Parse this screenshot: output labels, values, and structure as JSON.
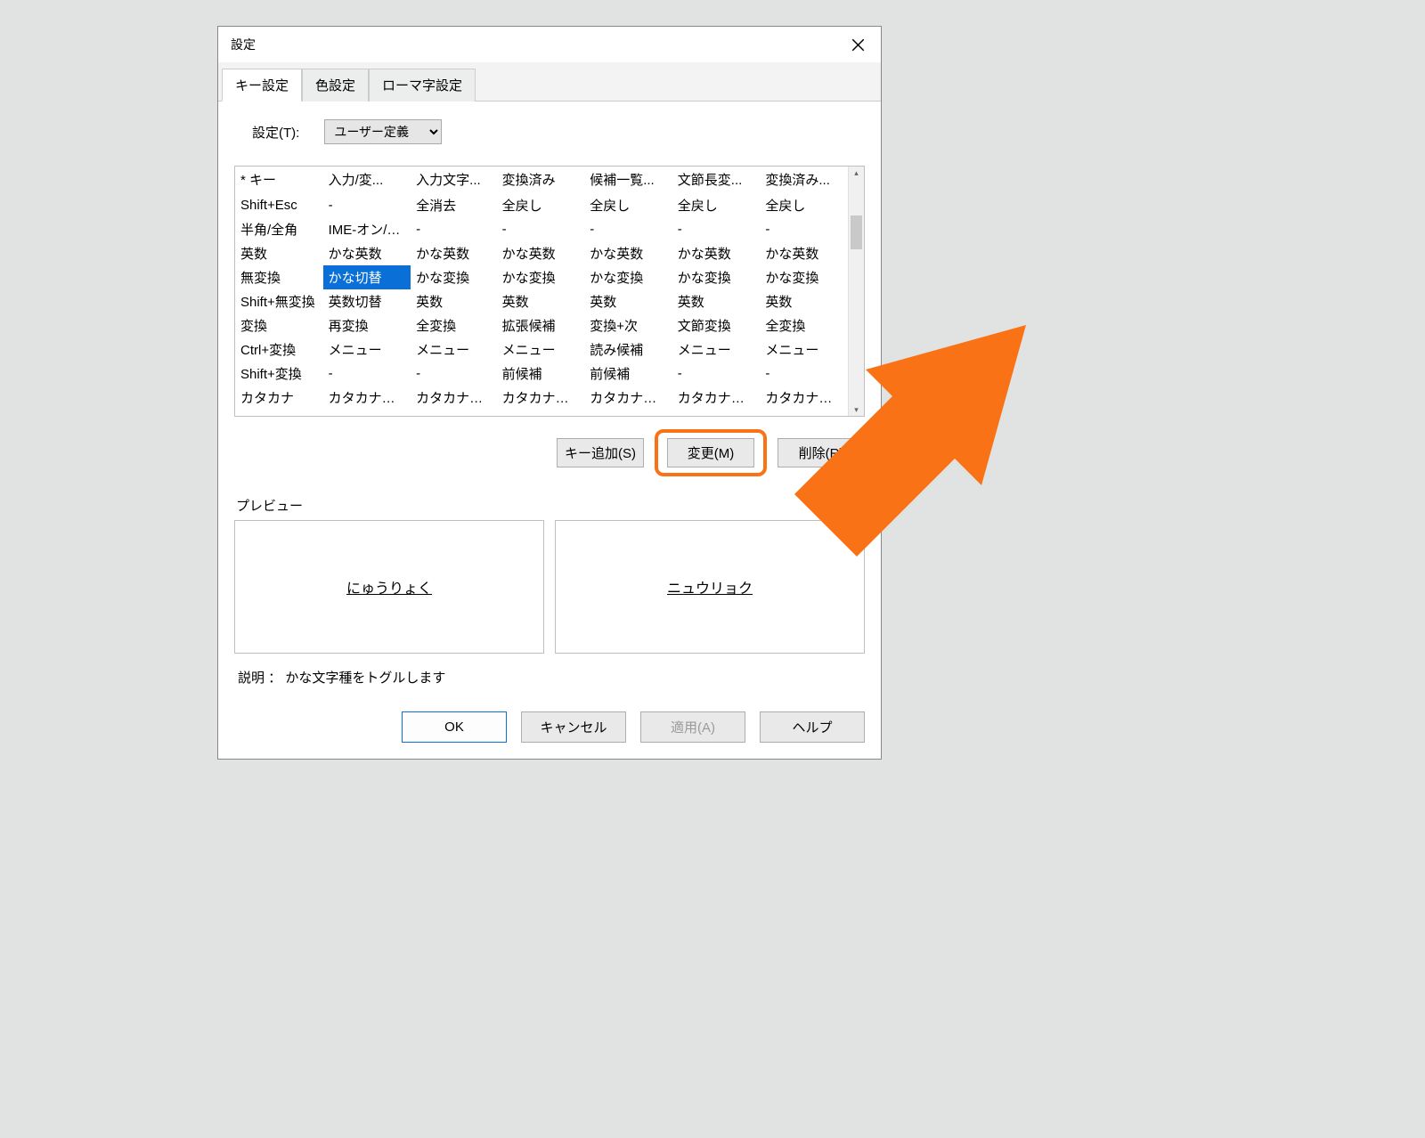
{
  "titlebar": {
    "title": "設定"
  },
  "tabs": [
    {
      "label": "キー設定",
      "active": true
    },
    {
      "label": "色設定",
      "active": false
    },
    {
      "label": "ローマ字設定",
      "active": false
    }
  ],
  "setting": {
    "label": "設定(T):",
    "selected": "ユーザー定義"
  },
  "table": {
    "headers": [
      "* キー",
      "入力/変...",
      "入力文字...",
      "変換済み",
      "候補一覧...",
      "文節長変...",
      "変換済み..."
    ],
    "rows": [
      [
        "Shift+Esc",
        "-",
        "全消去",
        "全戻し",
        "全戻し",
        "全戻し",
        "全戻し"
      ],
      [
        "半角/全角",
        "IME-オン/オフ",
        "-",
        "-",
        "-",
        "-",
        "-"
      ],
      [
        "英数",
        "かな英数",
        "かな英数",
        "かな英数",
        "かな英数",
        "かな英数",
        "かな英数"
      ],
      [
        "無変換",
        "かな切替",
        "かな変換",
        "かな変換",
        "かな変換",
        "かな変換",
        "かな変換"
      ],
      [
        "Shift+無変換",
        "英数切替",
        "英数",
        "英数",
        "英数",
        "英数",
        "英数"
      ],
      [
        "変換",
        "再変換",
        "全変換",
        "拡張候補",
        "変換+次",
        "文節変換",
        "全変換"
      ],
      [
        "Ctrl+変換",
        "メニュー",
        "メニュー",
        "メニュー",
        "読み候補",
        "メニュー",
        "メニュー"
      ],
      [
        "Shift+変換",
        "-",
        "-",
        "前候補",
        "前候補",
        "-",
        "-"
      ],
      [
        "カタカナ",
        "カタカナキー",
        "カタカナキー",
        "カタカナキー",
        "カタカナキー",
        "カタカナキー",
        "カタカナキー"
      ]
    ],
    "selected_cell": {
      "row": 3,
      "col": 1
    }
  },
  "actions": {
    "add_key": "キー追加(S)",
    "modify": "変更(M)",
    "delete": "削除(R)"
  },
  "preview": {
    "label": "プレビュー",
    "left": "にゅうりょく",
    "right": "ニュウリョク"
  },
  "description": "説明 ： かな文字種をトグルします",
  "footer": {
    "ok": "OK",
    "cancel": "キャンセル",
    "apply": "適用(A)",
    "help": "ヘルプ"
  },
  "annotation": {
    "arrow_color": "#f97316"
  }
}
